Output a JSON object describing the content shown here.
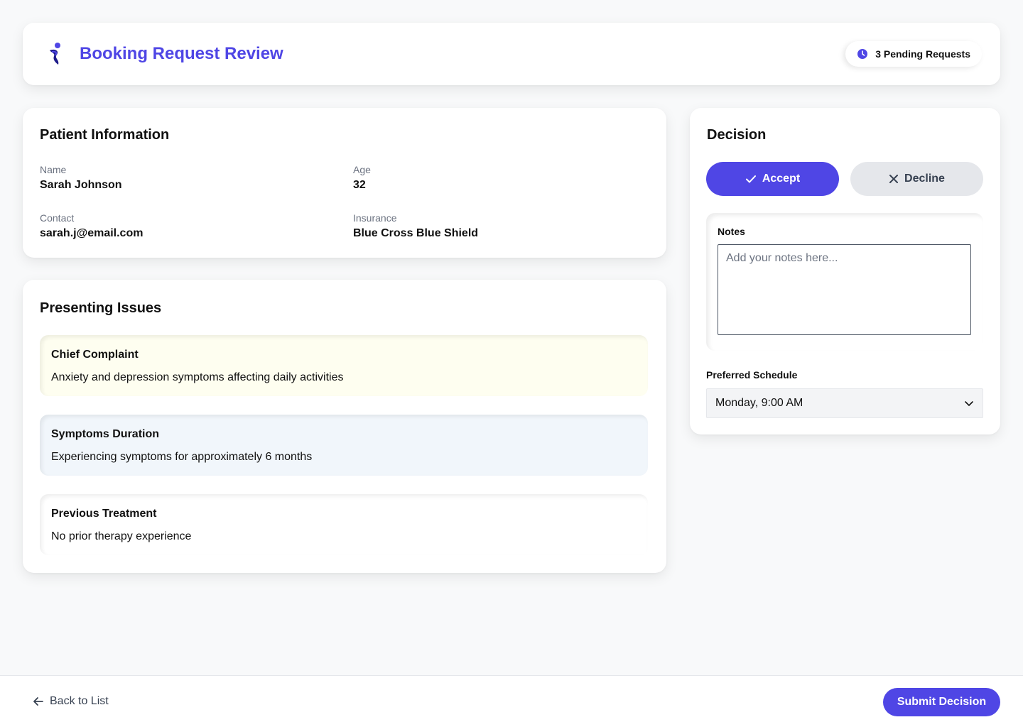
{
  "header": {
    "title": "Booking Request Review",
    "pending_badge": "3 Pending Requests",
    "logo_icon": "person-logo-icon",
    "badge_icon": "clock-icon"
  },
  "patient_info": {
    "title": "Patient Information",
    "fields": [
      {
        "label": "Name",
        "value": "Sarah Johnson"
      },
      {
        "label": "Age",
        "value": "32"
      },
      {
        "label": "Contact",
        "value": "sarah.j@email.com"
      },
      {
        "label": "Insurance",
        "value": "Blue Cross Blue Shield"
      }
    ]
  },
  "presenting_issues": {
    "title": "Presenting Issues",
    "items": [
      {
        "title": "Chief Complaint",
        "text": "Anxiety and depression symptoms affecting daily activities",
        "bg": "#fefef0"
      },
      {
        "title": "Symptoms Duration",
        "text": "Experiencing symptoms for approximately 6 months",
        "bg": "#f1f6fb"
      },
      {
        "title": "Previous Treatment",
        "text": "No prior therapy experience",
        "bg": "#ffffff"
      }
    ]
  },
  "decision": {
    "title": "Decision",
    "accept_label": "Accept",
    "decline_label": "Decline",
    "notes_label": "Notes",
    "notes_placeholder": "Add your notes here...",
    "schedule_label": "Preferred Schedule",
    "schedule_value": "Monday, 9:00 AM"
  },
  "footer": {
    "back_label": "Back to List",
    "submit_label": "Submit Decision"
  },
  "colors": {
    "accent": "#4f46e5",
    "background": "#f8f9fa",
    "decline_bg": "#e5e7eb"
  }
}
